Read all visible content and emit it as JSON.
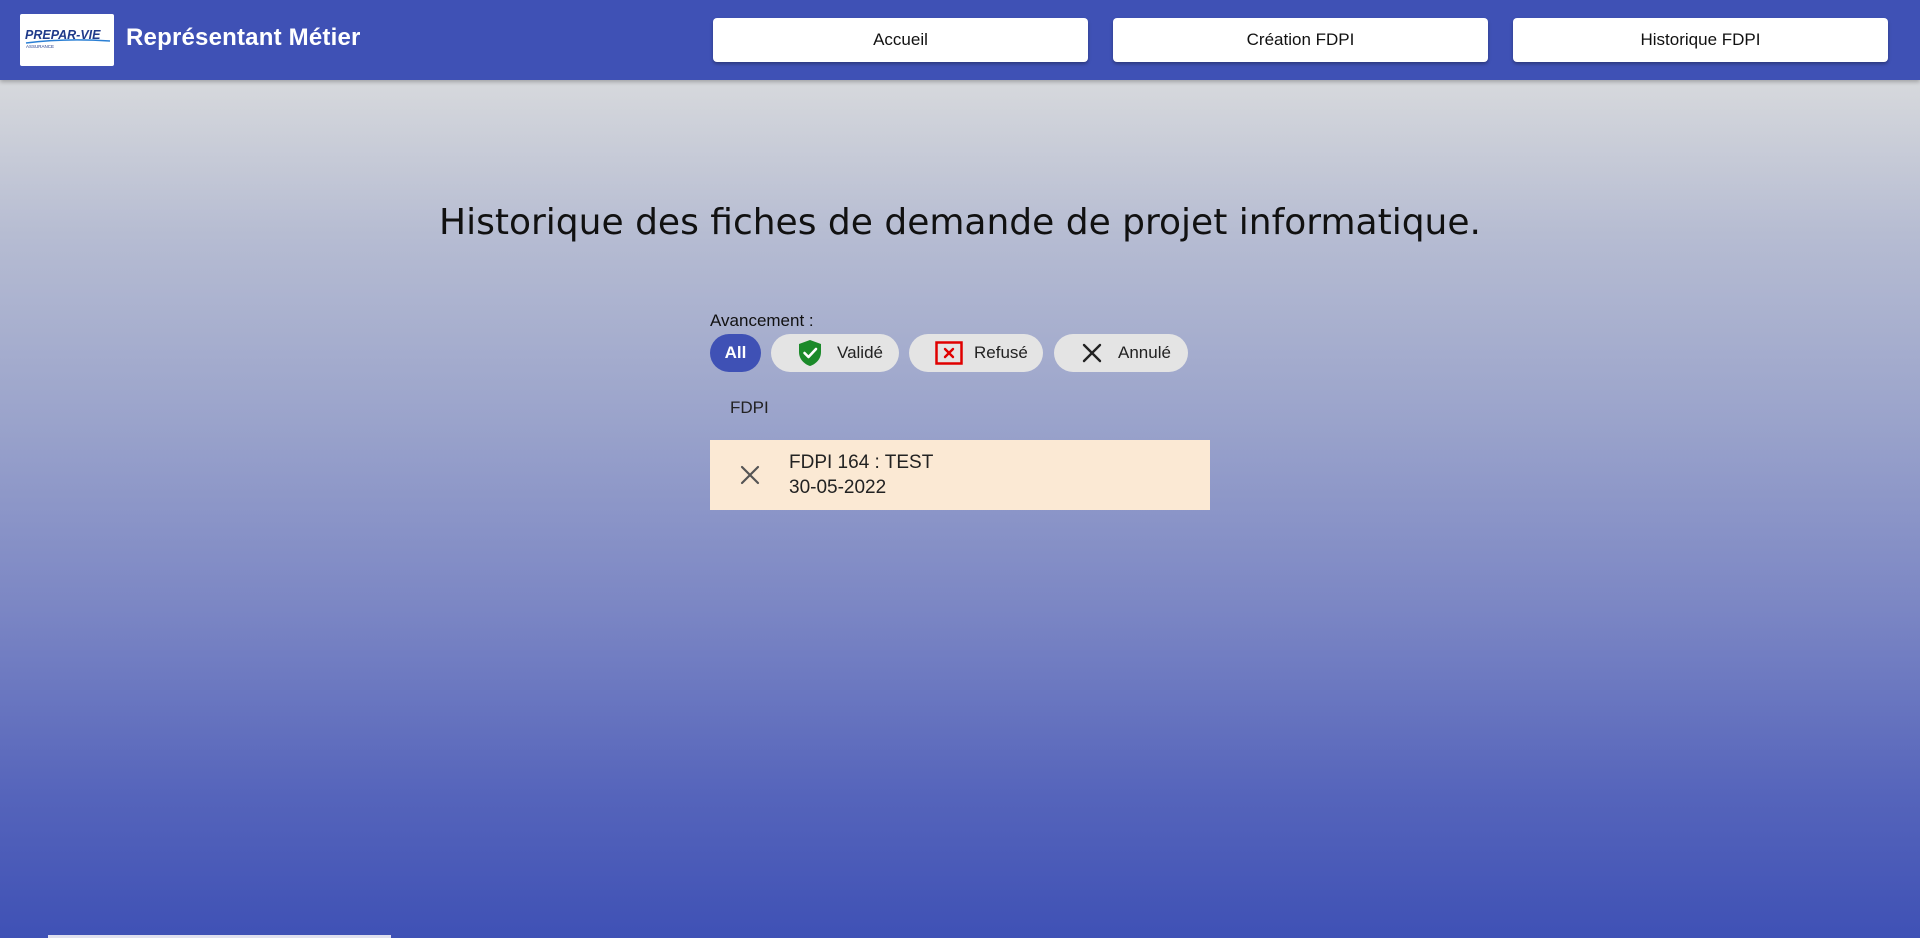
{
  "header": {
    "logo_text": "PREPAR-VIE",
    "logo_subtext": "ASSURANCE",
    "title": "Représentant Métier",
    "nav": [
      {
        "label": "Accueil"
      },
      {
        "label": "Création FDPI"
      },
      {
        "label": "Historique FDPI"
      }
    ],
    "background_color": "#3f51b5"
  },
  "page": {
    "title": "Historique des fiches de demande de projet informatique."
  },
  "filters": {
    "label": "Avancement :",
    "chips": [
      {
        "label": "All",
        "active": true,
        "icon": null
      },
      {
        "label": "Validé",
        "active": false,
        "icon": "shield-check-icon",
        "icon_color": "#1b8a2a"
      },
      {
        "label": "Refusé",
        "active": false,
        "icon": "square-x-icon",
        "icon_color": "#e00000"
      },
      {
        "label": "Annulé",
        "active": false,
        "icon": "close-icon",
        "icon_color": "#222222"
      }
    ]
  },
  "list": {
    "header": "FDPI",
    "items": [
      {
        "title": "FDPI 164 : TEST",
        "date": "30-05-2022",
        "status_icon": "close-icon",
        "background": "#fbe9d4"
      }
    ]
  }
}
